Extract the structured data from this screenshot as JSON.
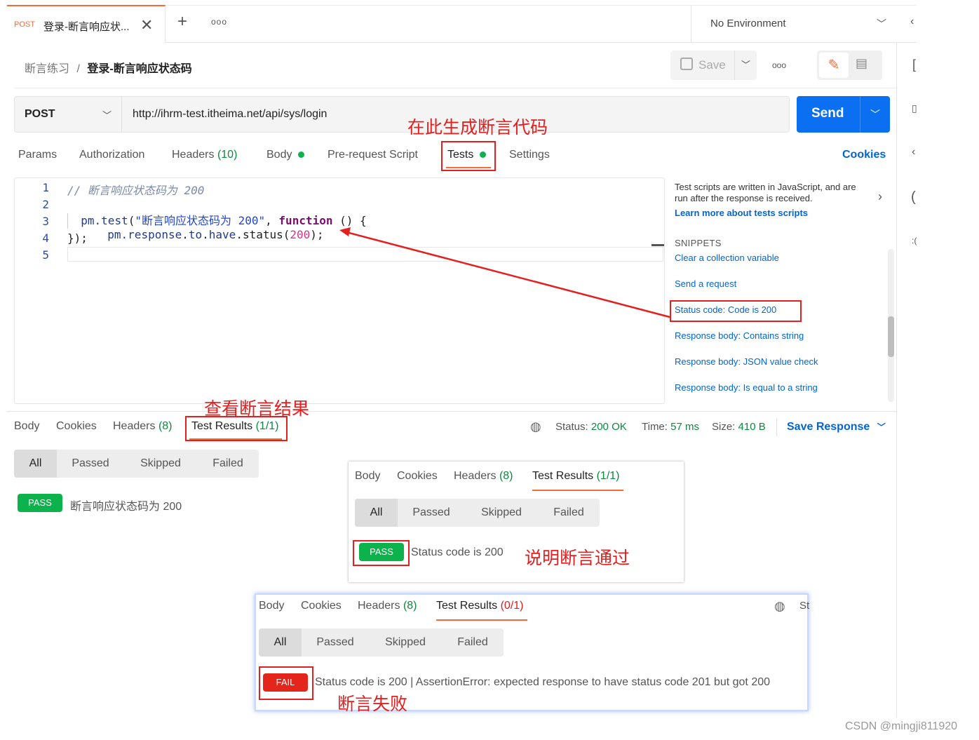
{
  "tab": {
    "method": "POST",
    "title": "登录-断言响应状...",
    "environment": "No Environment"
  },
  "breadcrumb": {
    "collection": "断言练习",
    "separator": "/",
    "request": "登录-断言响应状态码"
  },
  "toolbar": {
    "save_label": "Save"
  },
  "request": {
    "method": "POST",
    "url": "http://ihrm-test.itheima.net/api/sys/login",
    "send_label": "Send"
  },
  "req_tabs": {
    "params": "Params",
    "authorization": "Authorization",
    "headers": "Headers",
    "headers_count": "(10)",
    "body": "Body",
    "prerequest": "Pre-request Script",
    "tests": "Tests",
    "settings": "Settings",
    "cookies": "Cookies"
  },
  "editor": {
    "line_numbers": [
      "1",
      "2",
      "3",
      "4",
      "5"
    ],
    "comment": "// 断言响应状态码为 200",
    "l2_obj": "pm.",
    "l2_fn": "test",
    "l2_paren": "(",
    "l2_str": "\"断言响应状态码为 200\"",
    "l2_comma": ", ",
    "l2_kw": "function",
    "l2_rest": " () {",
    "l3_pre": "pm.",
    "l3_a": "response",
    "l3_dot1": ".",
    "l3_b": "to",
    "l3_dot2": ".",
    "l3_c": "have",
    "l3_d": ".status(",
    "l3_num": "200",
    "l3_end": ");",
    "l4": "});"
  },
  "side_panel": {
    "desc": "Test scripts are written in JavaScript, and are run after the response is received.",
    "learn_more": "Learn more about tests scripts",
    "snippets_heading": "SNIPPETS",
    "snippets": [
      "Clear a collection variable",
      "Send a request",
      "Status code: Code is 200",
      "Response body: Contains string",
      "Response body: JSON value check",
      "Response body: Is equal to a string"
    ]
  },
  "annotations": {
    "generate": "在此生成断言代码",
    "view_results": "查看断言结果",
    "pass_explain": "说明断言通过",
    "fail_explain": "断言失败"
  },
  "response": {
    "tabs": {
      "body": "Body",
      "cookies": "Cookies",
      "headers": "Headers",
      "headers_count": "(8)",
      "test_results": "Test Results",
      "test_count": "(1/1)"
    },
    "status_label": "Status:",
    "status_value": "200 OK",
    "time_label": "Time:",
    "time_value": "57 ms",
    "size_label": "Size:",
    "size_value": "410 B",
    "save_response": "Save Response",
    "filters": [
      "All",
      "Passed",
      "Skipped",
      "Failed"
    ],
    "result_badge": "PASS",
    "result_text": "断言响应状态码为 200"
  },
  "popup_pass": {
    "tabs": {
      "body": "Body",
      "cookies": "Cookies",
      "headers": "Headers",
      "headers_count": "(8)",
      "test_results": "Test Results",
      "test_count": "(1/1)"
    },
    "filters": [
      "All",
      "Passed",
      "Skipped",
      "Failed"
    ],
    "badge": "PASS",
    "text": "Status code is 200"
  },
  "popup_fail": {
    "tabs": {
      "body": "Body",
      "cookies": "Cookies",
      "headers": "Headers",
      "headers_count": "(8)",
      "test_results": "Test Results",
      "test_count": "(0/1)"
    },
    "status_clip": "St",
    "filters": [
      "All",
      "Passed",
      "Skipped",
      "Failed"
    ],
    "badge": "FAIL",
    "text": "Status code is 200 | AssertionError: expected response to have status code 201 but got 200"
  },
  "watermark": "CSDN @mingji811920",
  "colors": {
    "accent": "#f26b3a",
    "send": "#0b6ff2",
    "pass": "#0cb34c",
    "fail": "#e4251b",
    "annotation": "#e41f1f",
    "link": "#0265d2"
  }
}
